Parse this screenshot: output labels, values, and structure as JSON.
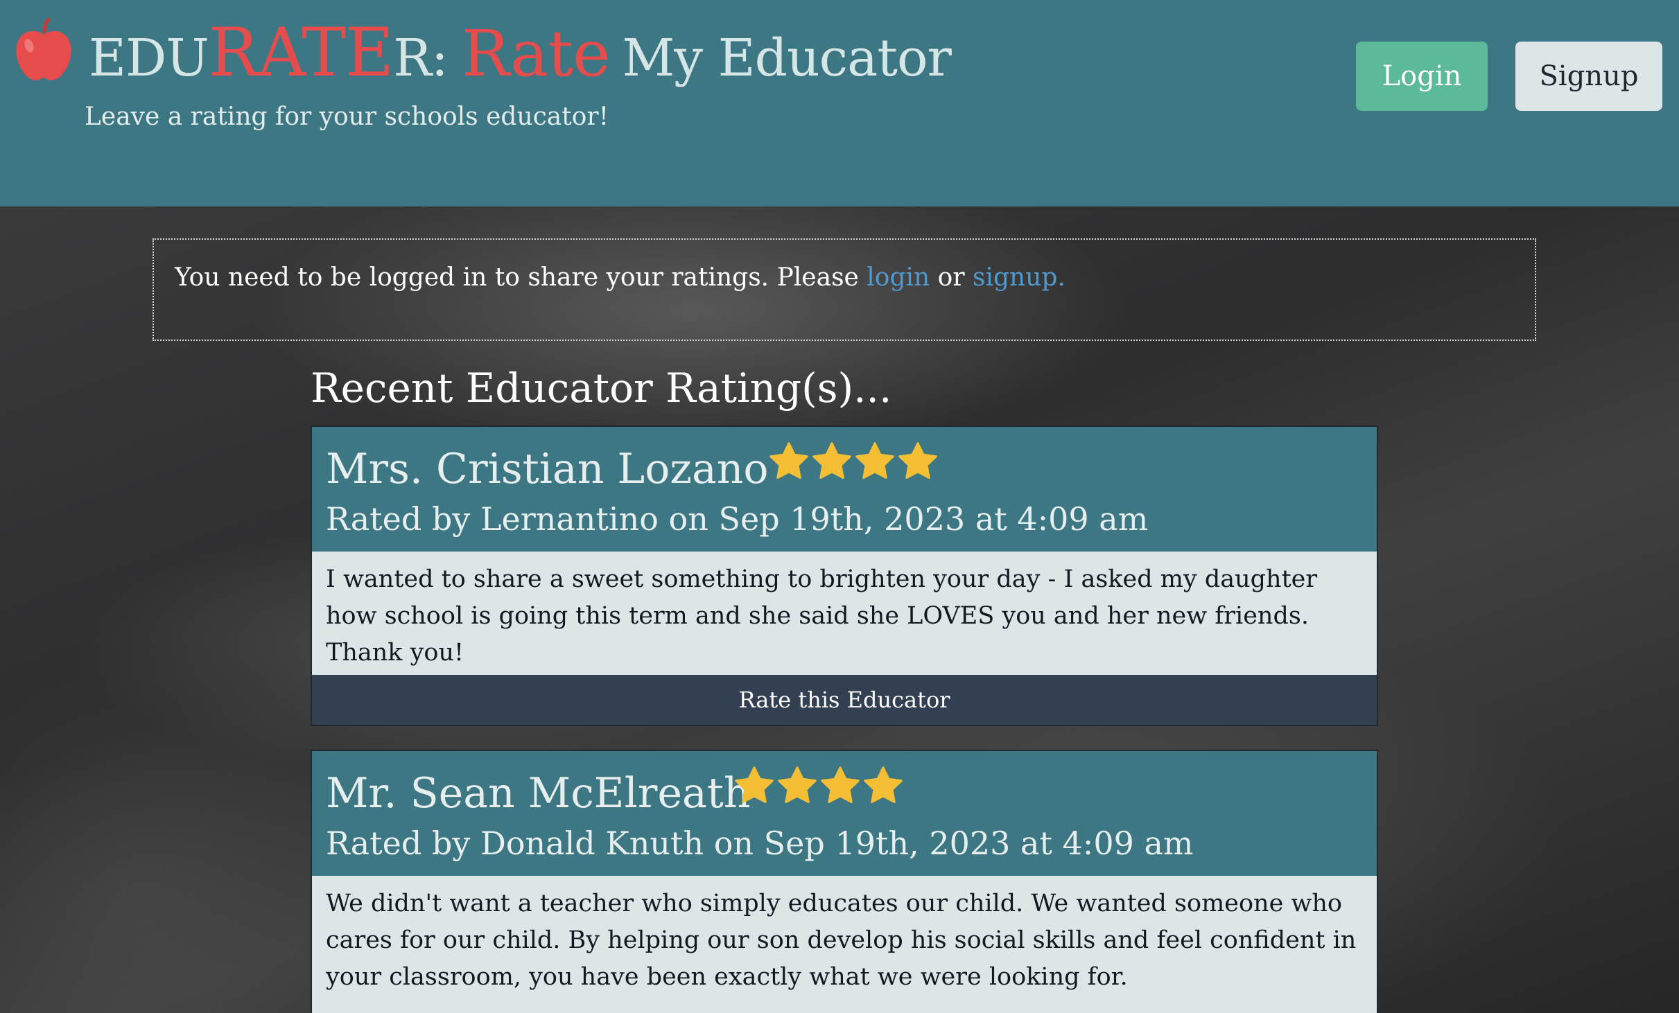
{
  "header": {
    "brand_edu": "EDU",
    "brand_rater": "RATE",
    "brand_r": "R:",
    "brand_rate": "Rate",
    "brand_rest": "My Educator",
    "tagline": "Leave a rating for your schools educator!",
    "login_label": "Login",
    "signup_label": "Signup"
  },
  "notice": {
    "text": "You need to be logged in to share your ratings. Please ",
    "login_link": "login",
    "or": " or ",
    "signup_link": "signup."
  },
  "section_title": "Recent Educator Rating(s)...",
  "ratings": [
    {
      "name": "Mrs. Cristian Lozano",
      "stars": 4,
      "meta": "Rated by Lernantino on Sep 19th, 2023 at 4:09 am",
      "body": "I wanted to share a sweet something to brighten your day - I asked my daughter how school is going this term and she said she LOVES you and her new friends. Thank you!",
      "action": "Rate this Educator"
    },
    {
      "name": "Mr. Sean McElreath",
      "stars": 4,
      "meta": "Rated by Donald Knuth on Sep 19th, 2023 at 4:09 am",
      "body": "We didn't want a teacher who simply educates our child. We wanted someone who cares for our child. By helping our son develop his social skills and feel confident in your classroom, you have been exactly what we were looking for."
    }
  ],
  "colors": {
    "header_bg": "#3e7784",
    "accent_red": "#e64c4c",
    "login_btn": "#5cb999",
    "star": "#f5bf35",
    "card_footer": "#334052",
    "link": "#4f9ad0"
  },
  "icons": {
    "logo": "apple-icon",
    "rating": "star-icon"
  }
}
